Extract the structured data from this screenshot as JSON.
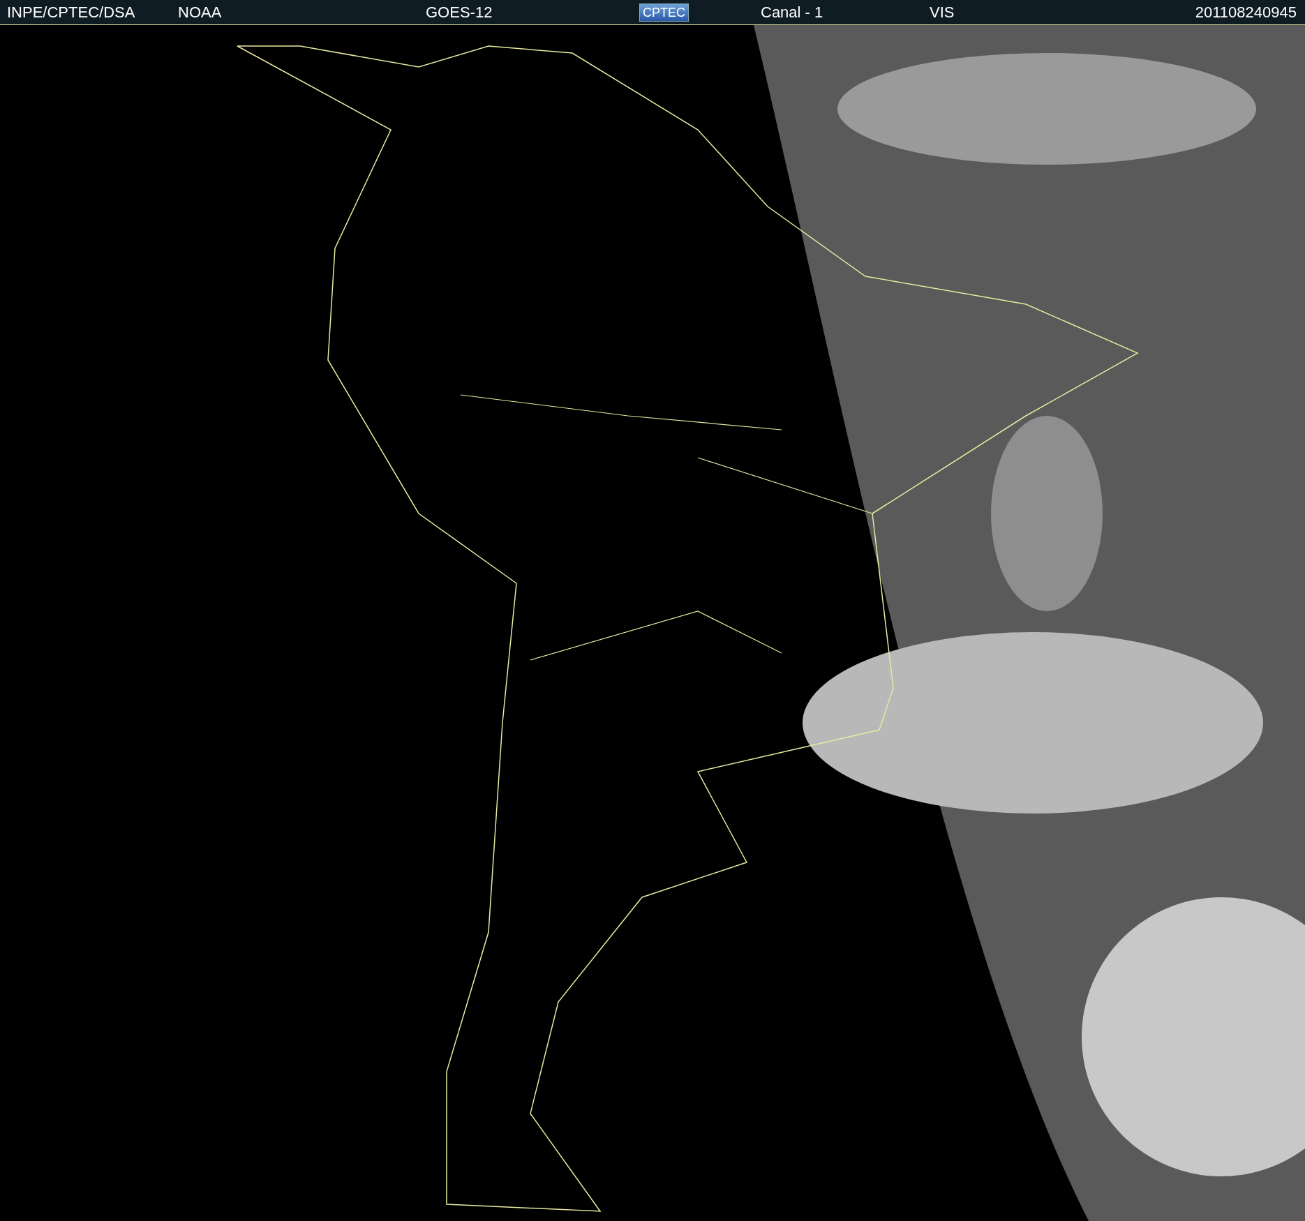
{
  "header": {
    "items": [
      {
        "kind": "text",
        "text": "INPE/CPTEC/DSA"
      },
      {
        "kind": "text",
        "text": "NOAA"
      },
      {
        "kind": "text",
        "text": "GOES-12"
      },
      {
        "kind": "logo",
        "text": "CPTEC"
      },
      {
        "kind": "text",
        "text": "Canal - 1"
      },
      {
        "kind": "text",
        "text": "VIS"
      },
      {
        "kind": "text",
        "text": "201108240945"
      }
    ]
  }
}
